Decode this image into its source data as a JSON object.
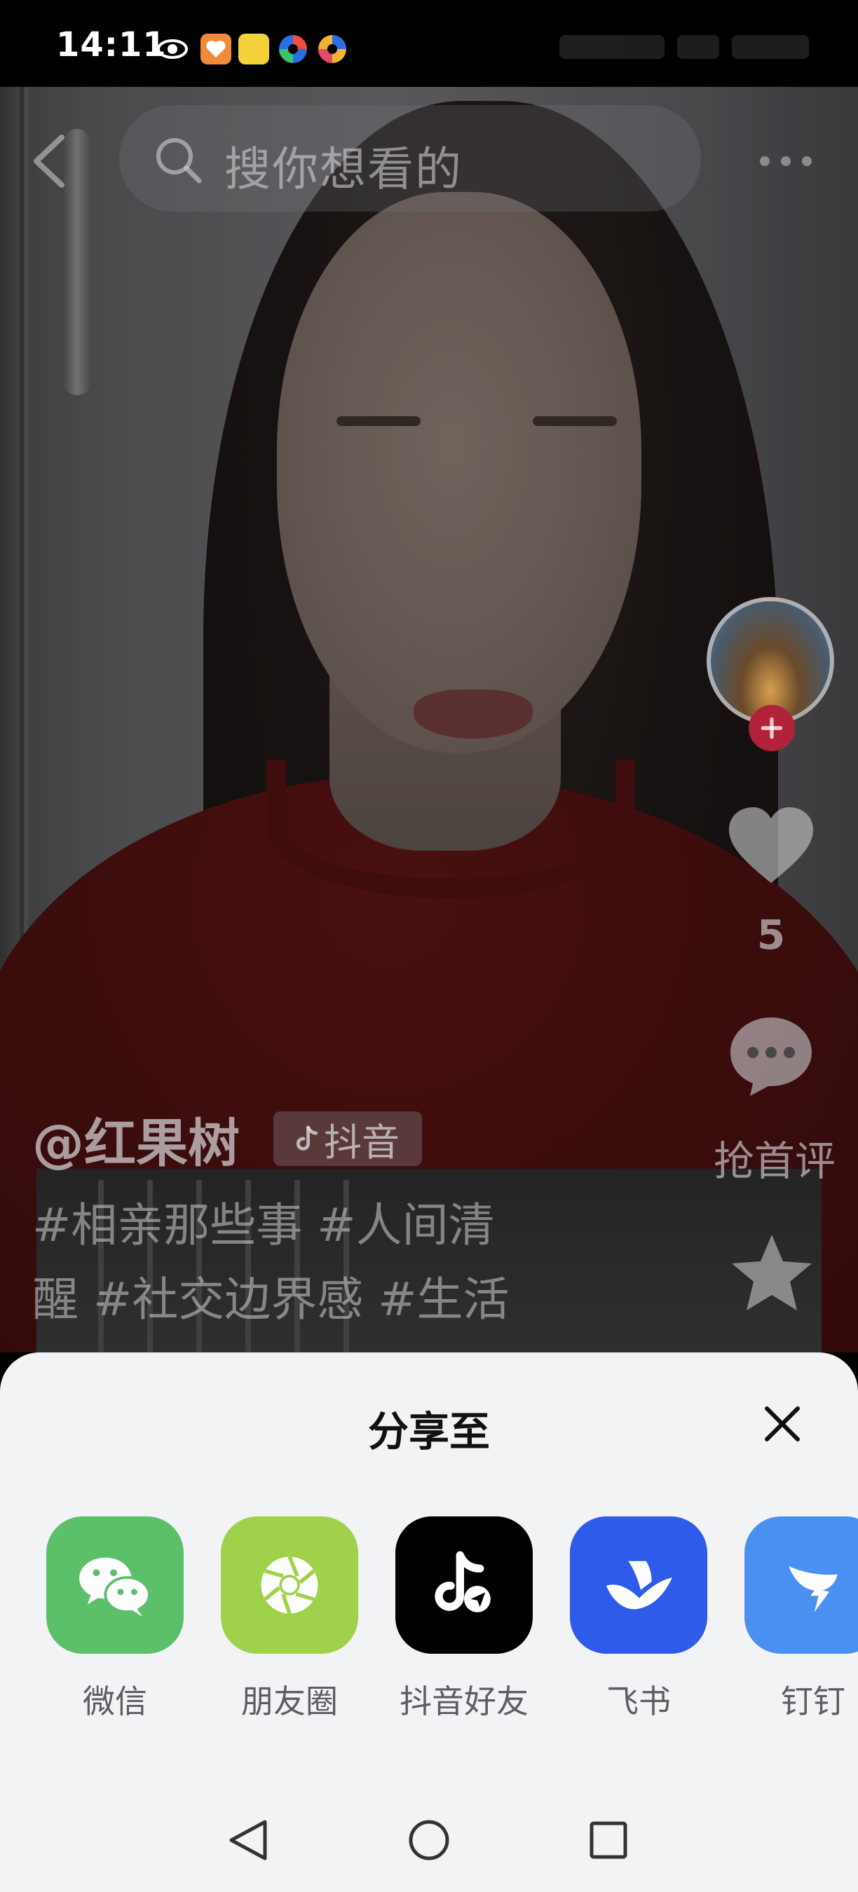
{
  "status_bar": {
    "time": "14:11"
  },
  "search": {
    "placeholder": "搜你想看的"
  },
  "video": {
    "author": "@红果树",
    "source_tag": "抖音",
    "hashtags_line1": "#相亲那些事 #人间清",
    "hashtags_line2": "醒 #社交边界感 #生活"
  },
  "actions": {
    "like_count": "5",
    "comment_label": "抢首评"
  },
  "share_sheet": {
    "title": "分享至",
    "targets": [
      {
        "label": "微信",
        "icon": "wechat-icon",
        "color": "#5cbf6a"
      },
      {
        "label": "朋友圈",
        "icon": "moments-icon",
        "color": "#9fd24a"
      },
      {
        "label": "抖音好友",
        "icon": "douyin-icon",
        "color": "#000000"
      },
      {
        "label": "飞书",
        "icon": "feishu-icon",
        "color": "#2f5bea"
      },
      {
        "label": "钉钉",
        "icon": "dingtalk-icon",
        "color": "#4a90f0"
      }
    ]
  },
  "colors": {
    "sheet_background": "#f2f3f5",
    "follow_accent": "#b0223a"
  }
}
